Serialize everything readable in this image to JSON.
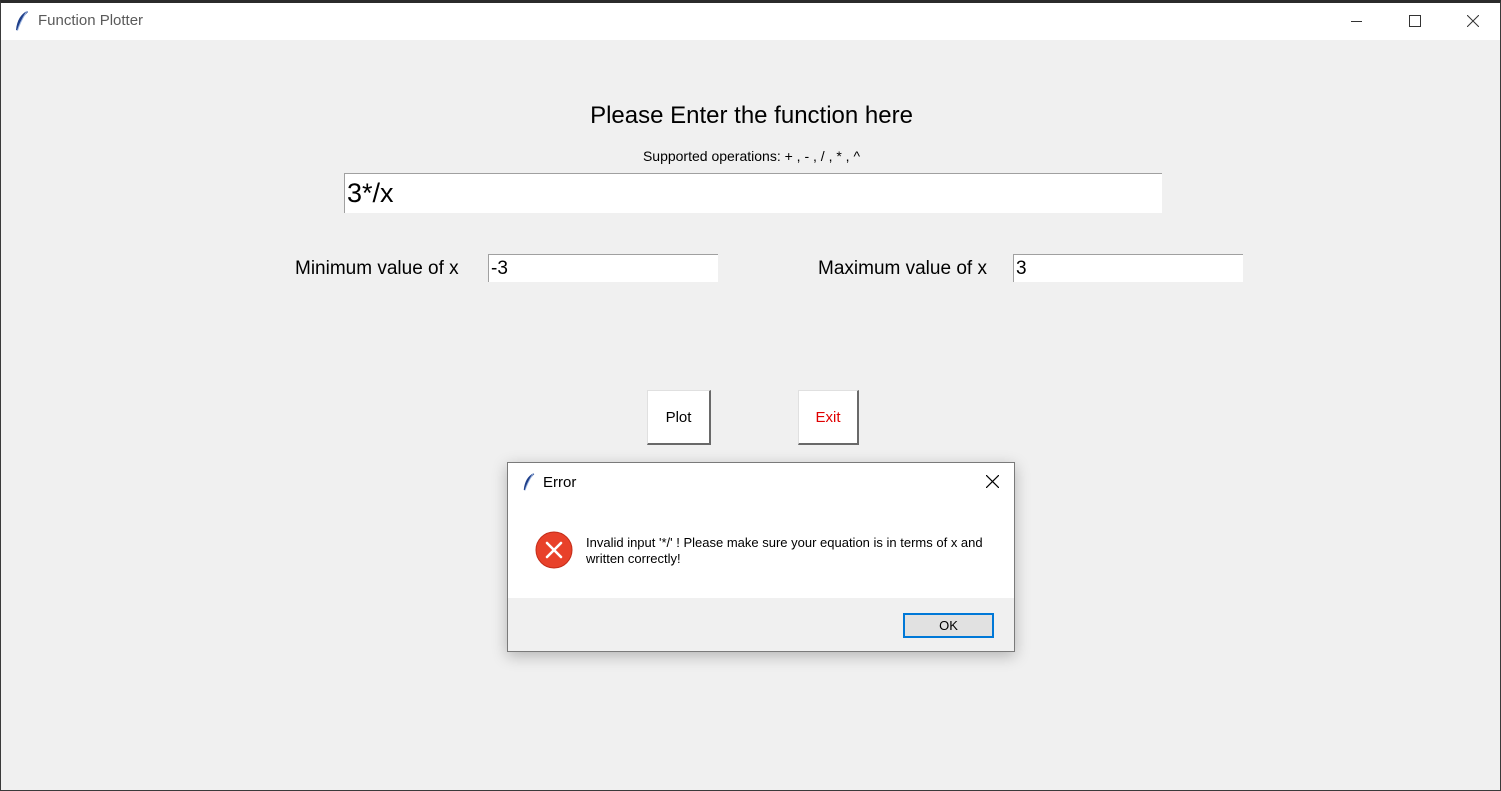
{
  "window": {
    "title": "Function Plotter",
    "icon": "feather-icon"
  },
  "main": {
    "heading": "Please Enter the function here",
    "subheading": "Supported operations: + , - , / , * , ^",
    "function_value": "3*/x",
    "min_label": "Minimum value of x",
    "min_value": "-3",
    "max_label": "Maximum value of x",
    "max_value": "3",
    "plot_label": "Plot",
    "exit_label": "Exit"
  },
  "dialog": {
    "title": "Error",
    "icon": "error-icon",
    "message": "Invalid input '*/' ! Please make sure your equation is in terms of x and written correctly!",
    "ok_label": "OK"
  },
  "colors": {
    "background": "#f0f0f0",
    "exit_text": "#e00000",
    "error_icon": "#e8412a",
    "focus_border": "#0078d7"
  }
}
